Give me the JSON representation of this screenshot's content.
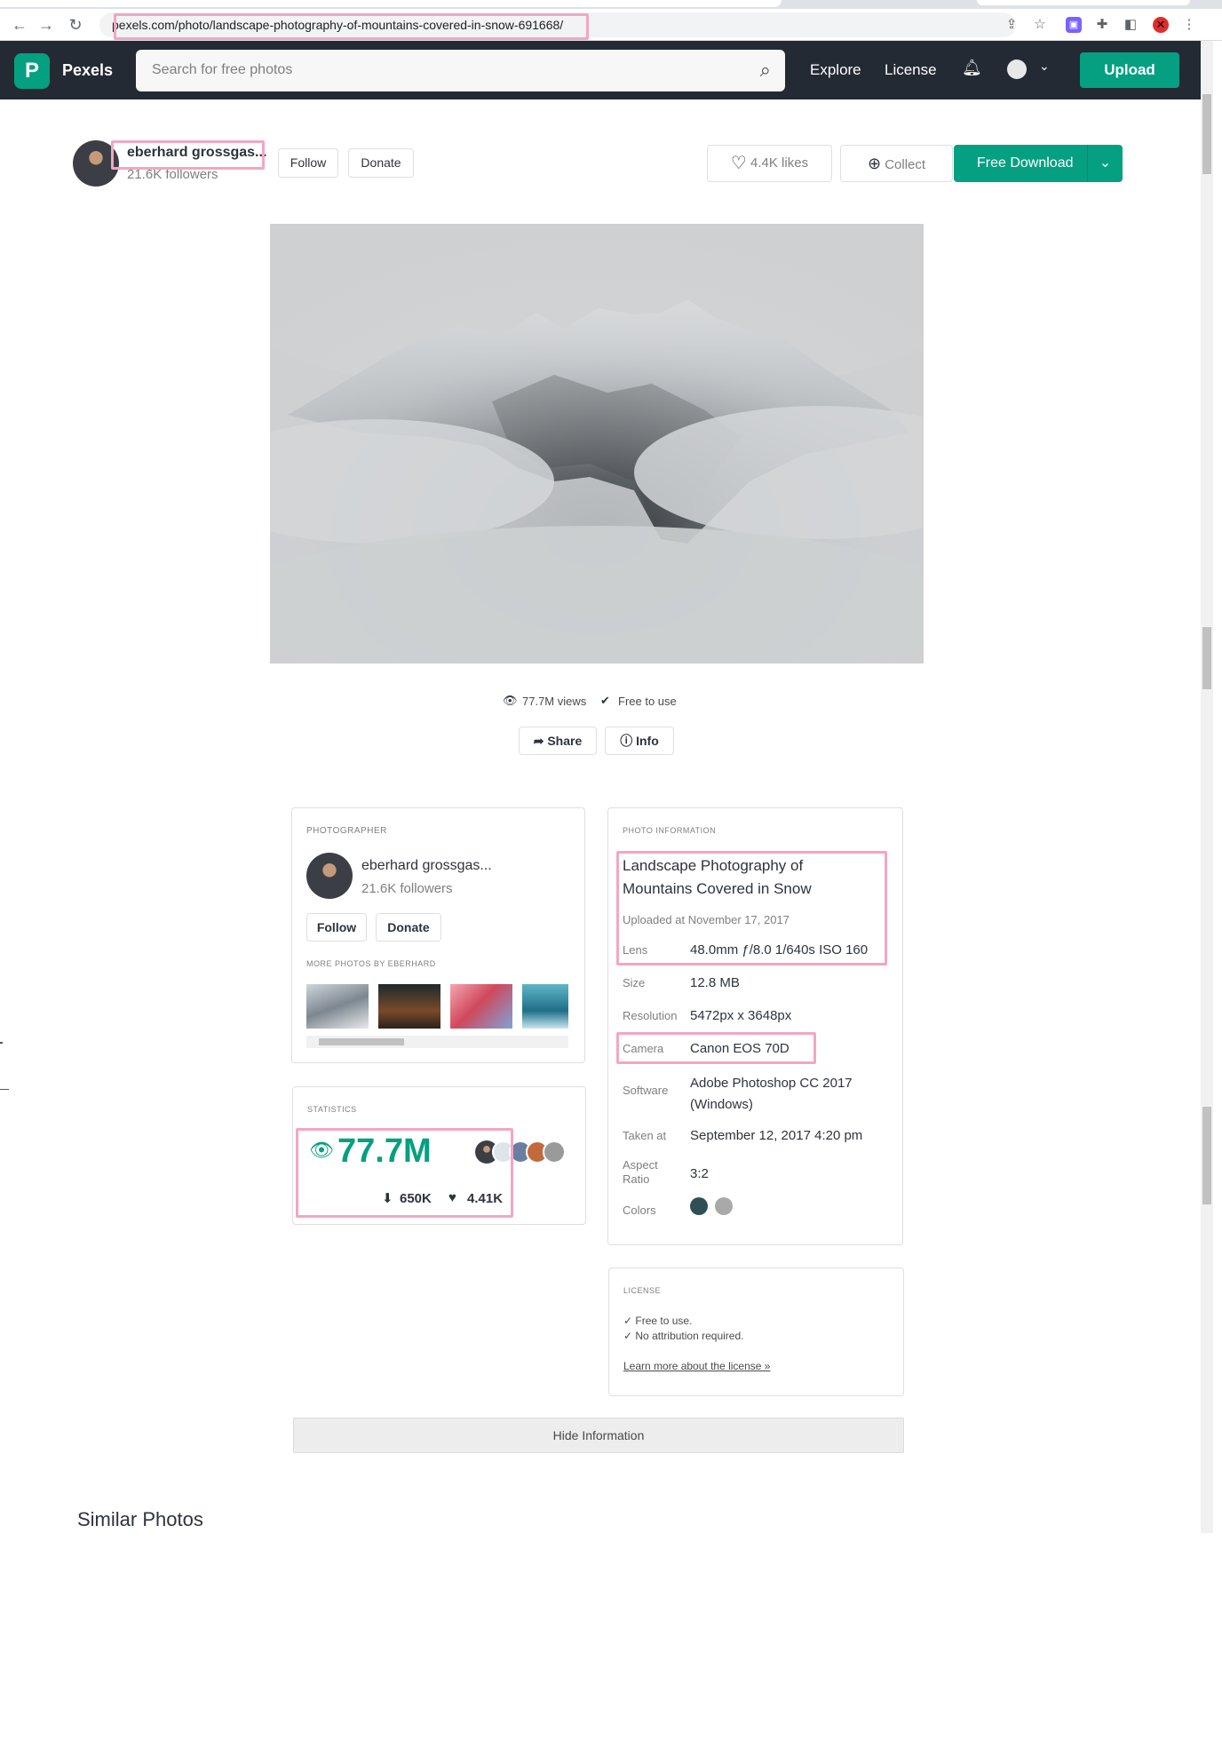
{
  "browser": {
    "url": "pexels.com/photo/landscape-photography-of-mountains-covered-in-snow-691668/",
    "back_icon": "arrow-left-icon",
    "forward_icon": "arrow-right-icon",
    "reload_icon": "reload-icon"
  },
  "header": {
    "brand": "Pexels",
    "search_placeholder": "Search for free photos",
    "nav": [
      "Explore",
      "License"
    ],
    "upload": "Upload"
  },
  "photographer": {
    "name": "eberhard grossgas...",
    "followers": "21.6K followers",
    "follow": "Follow",
    "donate": "Donate"
  },
  "actions": {
    "likes": "4.4K likes",
    "collect": "Collect",
    "download": "Free Download"
  },
  "photo_meta": {
    "views": "77.7M views",
    "free": "Free to use",
    "share": "Share",
    "info": "Info"
  },
  "photographer_card": {
    "heading": "PHOTOGRAPHER",
    "more_heading": "MORE PHOTOS BY EBERHARD"
  },
  "statistics": {
    "heading": "STATISTICS",
    "views": "77.7M",
    "downloads": "650K",
    "likes": "4.41K"
  },
  "photo_info": {
    "heading": "PHOTO INFORMATION",
    "title": "Landscape Photography of Mountains Covered in Snow",
    "uploaded": "Uploaded at November 17, 2017",
    "rows": [
      {
        "label": "Lens",
        "value": "48.0mm ƒ/8.0 1/640s ISO 160"
      },
      {
        "label": "Size",
        "value": "12.8 MB"
      },
      {
        "label": "Resolution",
        "value": "5472px x 3648px"
      },
      {
        "label": "Camera",
        "value": "Canon EOS 70D"
      },
      {
        "label": "Software",
        "value": "Adobe Photoshop CC 2017 (Windows)"
      },
      {
        "label": "Taken at",
        "value": "September 12, 2017 4:20 pm"
      },
      {
        "label": "Aspect Ratio",
        "value": "3:2"
      },
      {
        "label": "Colors",
        "value": ""
      }
    ],
    "colors": [
      "#2f4f55",
      "#a9a9a9"
    ]
  },
  "license": {
    "heading": "LICENSE",
    "line1": "✓ Free to use.",
    "line2": "✓ No attribution required.",
    "link": "Learn more about the license »"
  },
  "hide_info": "Hide Information",
  "similar_heading": "Similar Photos"
}
